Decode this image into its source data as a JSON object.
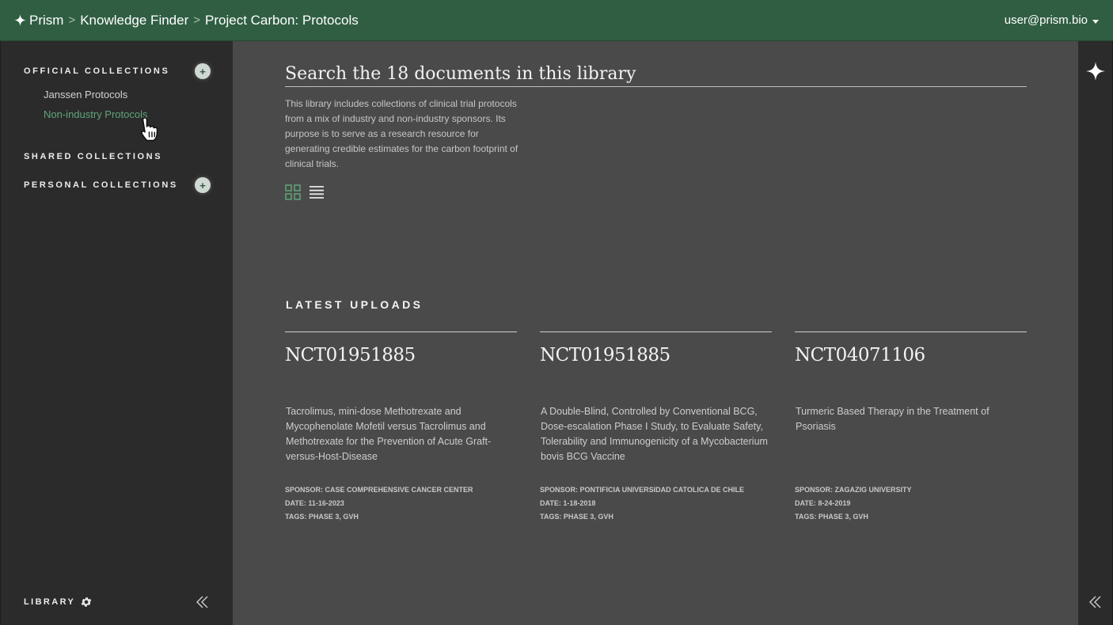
{
  "header": {
    "brand": "Prism",
    "breadcrumb": [
      "Knowledge Finder",
      "Project Carbon: Protocols"
    ],
    "separator": ">",
    "user": "user@prism.bio"
  },
  "sidebar": {
    "official_heading": "OFFICIAL COLLECTIONS",
    "official_items": [
      "Janssen Protocols",
      "Non-industry Protocols"
    ],
    "active_item": "Non-industry Protocols",
    "shared_heading": "SHARED COLLECTIONS",
    "personal_heading": "PERSONAL COLLECTIONS",
    "add_symbol": "+",
    "footer_label": "LIBRARY"
  },
  "main": {
    "search_placeholder": "Search the 18 documents in this library",
    "description": "This library includes collections of clinical trial protocols from a mix of industry and non-industry sponsors. Its purpose is to serve as a research resource for generating credible estimates for the carbon footprint of clinical trials.",
    "latest_heading": "LATEST UPLOADS",
    "cards": [
      {
        "id": "NCT01951885",
        "title": "Tacrolimus, mini-dose Methotrexate and Mycophenolate Mofetil versus Tacrolimus and Methotrexate for the Prevention of Acute Graft-versus-Host-Disease",
        "sponsor": "SPONSOR: CASE COMPREHENSIVE CANCER CENTER",
        "date": "DATE: 11-16-2023",
        "tags": "TAGS: PHASE 3, GVH"
      },
      {
        "id": "NCT01951885",
        "title": "A Double-Blind, Controlled by Conventional BCG, Dose-escalation Phase I Study, to Evaluate Safety, Tolerability and Immunogenicity of a Mycobacterium bovis BCG Vaccine",
        "sponsor": "SPONSOR: PONTIFICIA UNIVERSIDAD CATOLICA DE CHILE",
        "date": "DATE: 1-18-2018",
        "tags": "TAGS: PHASE 3, GVH"
      },
      {
        "id": "NCT04071106",
        "title": "Turmeric Based Therapy in the Treatment of Psoriasis",
        "sponsor": "SPONSOR: ZAGAZIG UNIVERSITY",
        "date": "DATE: 8-24-2019",
        "tags": "TAGS: PHASE 3, GVH"
      }
    ]
  },
  "icons": [
    "sparkle-icon",
    "caret-down-icon",
    "plus-icon",
    "pointer-hand-icon",
    "gear-icon",
    "double-chevron-left-icon",
    "grid-view-icon",
    "list-view-icon"
  ],
  "colors": {
    "header_bg": "#305e42",
    "sidebar_bg": "#2b2b2b",
    "main_bg": "#4a4a4a",
    "accent_green": "#5fa57a"
  }
}
